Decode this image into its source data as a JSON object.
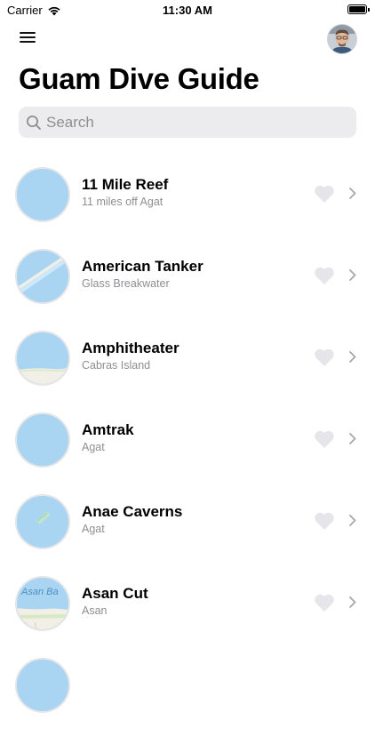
{
  "status_bar": {
    "carrier": "Carrier",
    "time": "11:30 AM"
  },
  "header": {
    "title": "Guam Dive Guide"
  },
  "search": {
    "placeholder": "Search",
    "value": ""
  },
  "dive_sites": [
    {
      "name": "11 Mile Reef",
      "location": "11 miles off Agat",
      "map": "open-water"
    },
    {
      "name": "American Tanker",
      "location": "Glass Breakwater",
      "map": "breakwater"
    },
    {
      "name": "Amphitheater",
      "location": "Cabras Island",
      "map": "shoreline"
    },
    {
      "name": "Amtrak",
      "location": "Agat",
      "map": "open-water"
    },
    {
      "name": "Anae Caverns",
      "location": "Agat",
      "map": "reef-island"
    },
    {
      "name": "Asan Cut",
      "location": "Asan",
      "map": "bay-label",
      "map_label": "Asan Ba"
    }
  ],
  "colors": {
    "water": "#a9d5f2",
    "land": "#f1efe6",
    "heart": "#e5e5ea",
    "chevron": "#a7a7ab",
    "secondary_text": "#8e8e93"
  }
}
